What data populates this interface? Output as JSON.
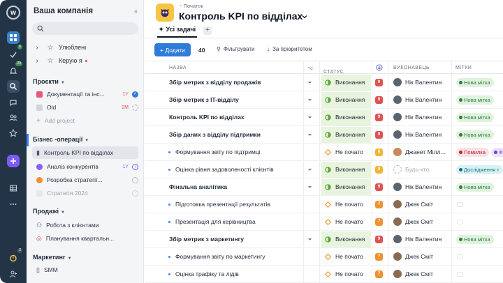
{
  "rail": {
    "logo_letter": "w",
    "badge_inbox": "6",
    "badge_notifications": "29",
    "badge_bottom": "2"
  },
  "sidebar": {
    "workspace": "Ваша компанія",
    "collapse_icon": "«",
    "favorites": "Улюблені",
    "managed_by_me": "Керую я",
    "projects": {
      "title": "Проєкти",
      "items": [
        {
          "label": "Документації та інс...",
          "tag": "1Y",
          "color": "#e8587a"
        },
        {
          "label": "Old",
          "tag": "2M",
          "color": "#d1d5db"
        }
      ],
      "add": "Add project"
    },
    "biz": {
      "title": "Бізнес -операції",
      "items": [
        {
          "label": "Контроль KPI по відділах"
        },
        {
          "label": "Аналіз конкурентів",
          "tag": "1Y"
        },
        {
          "label": "Розробка стратегії..."
        },
        {
          "label": "Стратегія 2024"
        }
      ]
    },
    "sales": {
      "title": "Продажі",
      "items": [
        {
          "label": "Робота з клієнтами"
        },
        {
          "label": "Планування квартальн..."
        }
      ]
    },
    "marketing": {
      "title": "Маркетинг",
      "items": [
        {
          "label": "SMM"
        }
      ]
    }
  },
  "header": {
    "breadcrumb": "Початок",
    "title": "Контроль KPI по відділах",
    "tab_all": "Усі задачі",
    "tab_add": "+"
  },
  "toolbar": {
    "add_label": "+ Додати",
    "count": "40",
    "filter_label": "Фільтрувати",
    "sort_label": "За пріоритетом"
  },
  "columns": {
    "name": "НАЗВА",
    "status": "СТАТУС",
    "assignee": "ВИКОНАВЕЦЬ",
    "labels": "МІТКИ"
  },
  "colors": {
    "accent": "#2f7bd9",
    "done_bg": "#e8f4dd",
    "prio_red": "#e05252",
    "prio_yellow": "#f2b632",
    "prio_orange": "#f0912f"
  },
  "rows": [
    {
      "name": "Збір метрик з відділу продажів",
      "bold": true,
      "expand": true,
      "status": "Виконання",
      "done": true,
      "prio": "9",
      "prio_color": "#e05252",
      "assignee": "Нік Валентин",
      "labels": [
        {
          "text": "Нова мітка",
          "cls": "lbl-green"
        }
      ]
    },
    {
      "name": "Збір метрик з IT-відділу",
      "bold": true,
      "expand": true,
      "status": "Виконання",
      "done": true,
      "prio": "9",
      "prio_color": "#e05252",
      "assignee": "Нік Валентин",
      "labels": [
        {
          "text": "Нова мітка",
          "cls": "lbl-green"
        }
      ]
    },
    {
      "name": "Контроль KPI по відділах",
      "bold": true,
      "expand": true,
      "status": "Виконання",
      "done": true,
      "prio": "9",
      "prio_color": "#e05252",
      "assignee": "Нік Валентин",
      "labels": [
        {
          "text": "Нова мітка",
          "cls": "lbl-green"
        }
      ]
    },
    {
      "name": "Збір даних з відділу підтримки",
      "bold": true,
      "expand": true,
      "status": "Виконання",
      "done": true,
      "prio": "9",
      "prio_color": "#e05252",
      "assignee": "Нік Валентин",
      "labels": [
        {
          "text": "Нова мітка",
          "cls": "lbl-green"
        }
      ]
    },
    {
      "name": "Формування звіту по підтримці",
      "bold": false,
      "expand": false,
      "status": "Не почато",
      "done": false,
      "prio": "8",
      "prio_color": "#f2b632",
      "assignee": "Джанет Мілл...",
      "labels": [
        {
          "text": "Помилка",
          "cls": "lbl-red"
        },
        {
          "text": "Ф",
          "cls": "lbl-purple"
        }
      ]
    },
    {
      "name": "Оцінка рівня задоволеності клієнтів",
      "bold": false,
      "expand": true,
      "status": "Виконання",
      "done": true,
      "prio": "8",
      "prio_color": "#f2b632",
      "assignee": "Будь-хто",
      "ghost": true,
      "labels": [
        {
          "text": "Дослідження т",
          "cls": "lbl-teal"
        }
      ]
    },
    {
      "name": "Фінальна аналітика",
      "bold": true,
      "expand": true,
      "status": "Виконання",
      "done": true,
      "prio": "9",
      "prio_color": "#e05252",
      "assignee": "Нік Валентин",
      "labels": [
        {
          "text": "Нова мітка",
          "cls": "lbl-green"
        }
      ]
    },
    {
      "name": "Підготовка презентації результатів",
      "bold": false,
      "expand": false,
      "status": "Не почато",
      "done": false,
      "prio": "7",
      "prio_color": "#f0912f",
      "assignee": "Джек Сміт",
      "labels": []
    },
    {
      "name": "Презентація для керівництва",
      "bold": false,
      "expand": false,
      "status": "Не почато",
      "done": false,
      "prio": "7",
      "prio_color": "#f0912f",
      "assignee": "Джек Сміт",
      "labels": []
    },
    {
      "name": "Збір метрик з маркетингу",
      "bold": true,
      "expand": true,
      "status": "Виконання",
      "done": true,
      "prio": "9",
      "prio_color": "#e05252",
      "assignee": "Нік Валентин",
      "labels": [
        {
          "text": "Нова мітка",
          "cls": "lbl-green"
        }
      ]
    },
    {
      "name": "Формування звіту по маркетингу",
      "bold": false,
      "expand": false,
      "status": "Не почато",
      "done": false,
      "prio": "7",
      "prio_color": "#f0912f",
      "assignee": "Джек Сміт",
      "labels": []
    },
    {
      "name": "Оцінка трафіку та лідів",
      "bold": false,
      "expand": false,
      "status": "Не почато",
      "done": false,
      "prio": "7",
      "prio_color": "#f0912f",
      "assignee": "Джек Сміт",
      "labels": []
    }
  ]
}
